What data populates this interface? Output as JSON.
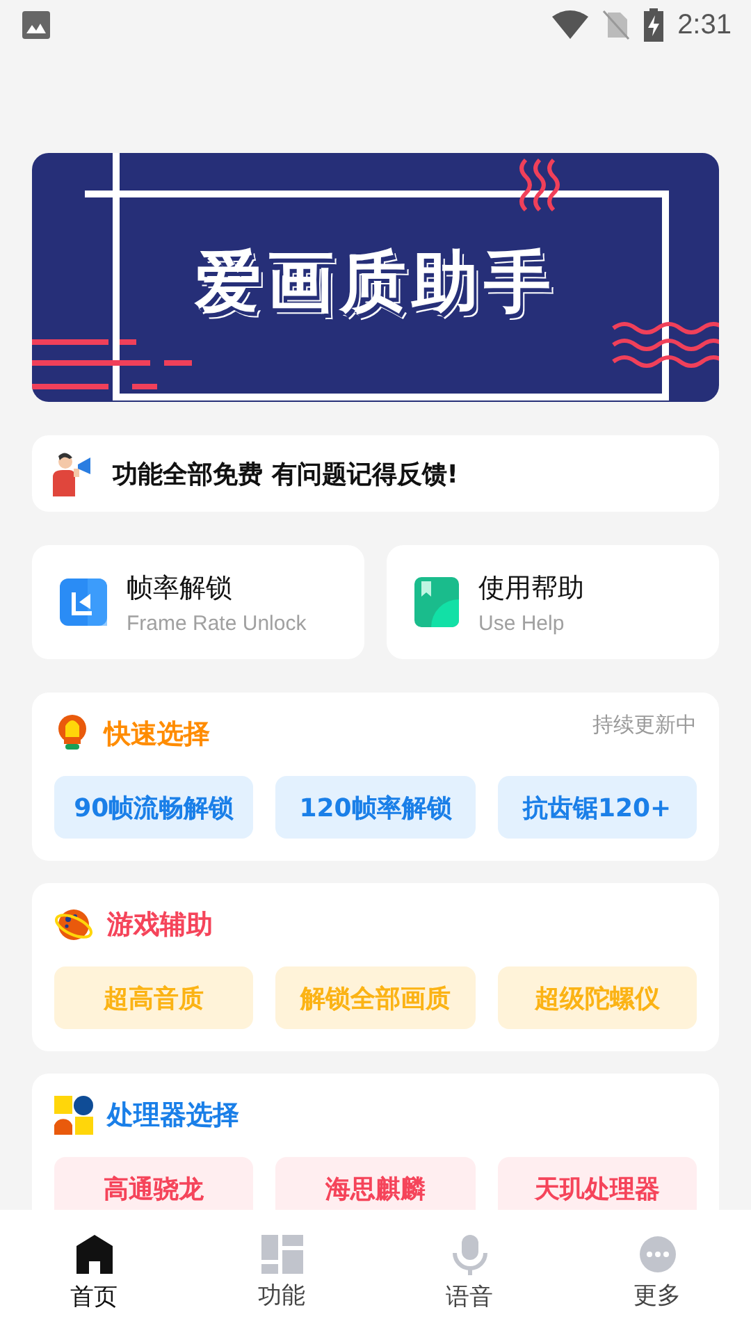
{
  "status_bar": {
    "time": "2:31"
  },
  "banner": {
    "title": "爱画质助手"
  },
  "notice": {
    "text": "功能全部免费 有问题记得反馈!"
  },
  "shortcuts": [
    {
      "kind": "frame",
      "title": "帧率解锁",
      "subtitle": "Frame Rate Unlock"
    },
    {
      "kind": "help",
      "title": "使用帮助",
      "subtitle": "Use Help"
    }
  ],
  "sections": [
    {
      "kind": "bulb",
      "title": "快速选择",
      "note": "持续更新中",
      "color": "#ff8c00",
      "options": [
        "90帧流畅解锁",
        "120帧率解锁",
        "抗齿锯120+"
      ]
    },
    {
      "kind": "planet",
      "title": "游戏辅助",
      "color": "#f5445a",
      "options": [
        "超高音质",
        "解锁全部画质",
        "超级陀螺仪"
      ]
    },
    {
      "kind": "tiles",
      "title": "处理器选择",
      "color": "#1a7fe8",
      "options": [
        "高通骁龙",
        "海思麒麟",
        "天玑处理器"
      ]
    }
  ],
  "bottom_nav": [
    {
      "kind": "home",
      "label": "首页",
      "selected": true
    },
    {
      "kind": "grid",
      "label": "功能",
      "selected": false
    },
    {
      "kind": "voice",
      "label": "语音",
      "selected": false
    },
    {
      "kind": "more",
      "label": "更多",
      "selected": false
    }
  ]
}
